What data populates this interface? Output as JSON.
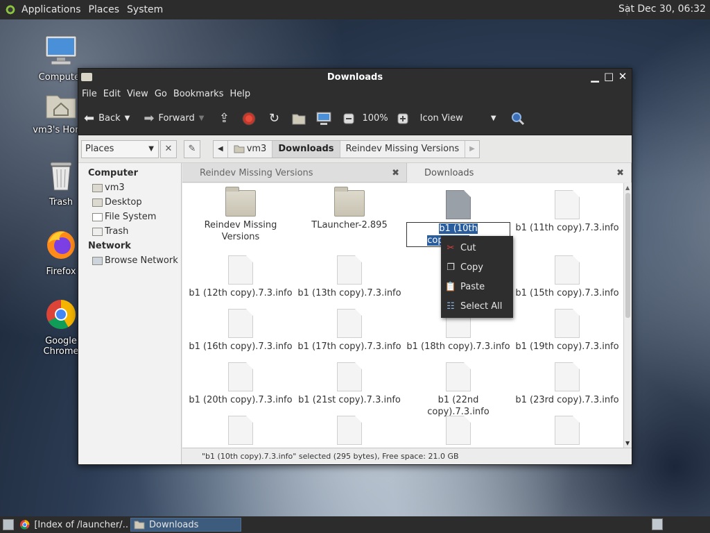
{
  "top_panel": {
    "menus": [
      "Applications",
      "Places",
      "System"
    ],
    "clock": "Sat Dec 30, 06:32"
  },
  "desktop_icons": [
    {
      "label": "Computer"
    },
    {
      "label": "vm3's Home"
    },
    {
      "label": "Trash"
    },
    {
      "label": "Firefox"
    },
    {
      "label": "Google Chrome"
    }
  ],
  "window": {
    "title": "Downloads",
    "menubar": [
      "File",
      "Edit",
      "View",
      "Go",
      "Bookmarks",
      "Help"
    ],
    "toolbar": {
      "back": "Back",
      "forward": "Forward",
      "zoom": "100%",
      "view_mode": "Icon View"
    },
    "location": {
      "places_label": "Places",
      "crumbs": [
        "vm3",
        "Downloads",
        "Reindev Missing Versions"
      ]
    },
    "sidebar": {
      "computer_head": "Computer",
      "computer_items": [
        "vm3",
        "Desktop",
        "File System",
        "Trash"
      ],
      "network_head": "Network",
      "network_items": [
        "Browse Network"
      ]
    },
    "tabs": [
      {
        "label": "Reindev Missing Versions"
      },
      {
        "label": "Downloads"
      }
    ],
    "files": [
      {
        "name": "Reindev Missing Versions",
        "type": "folder"
      },
      {
        "name": "TLauncher-2.895",
        "type": "folder"
      },
      {
        "name": "b1 (10th copy).7.3.info",
        "type": "doc",
        "selected": true,
        "rename_highlight": "b1 (10th copy).7.3",
        "rename_rest": ".info"
      },
      {
        "name": "b1 (11th copy).7.3.info",
        "type": "doc"
      },
      {
        "name": "b1 (12th copy).7.3.info",
        "type": "doc"
      },
      {
        "name": "b1 (13th copy).7.3.info",
        "type": "doc"
      },
      {
        "name": "b1 (14t",
        "type": "doc"
      },
      {
        "name": "b1 (15th copy).7.3.info",
        "type": "doc"
      },
      {
        "name": "b1 (16th copy).7.3.info",
        "type": "doc"
      },
      {
        "name": "b1 (17th copy).7.3.info",
        "type": "doc"
      },
      {
        "name": "b1 (18th copy).7.3.info",
        "type": "doc"
      },
      {
        "name": "b1 (19th copy).7.3.info",
        "type": "doc"
      },
      {
        "name": "b1 (20th copy).7.3.info",
        "type": "doc"
      },
      {
        "name": "b1 (21st copy).7.3.info",
        "type": "doc"
      },
      {
        "name": "b1 (22nd copy).7.3.info",
        "type": "doc"
      },
      {
        "name": "b1 (23rd copy).7.3.info",
        "type": "doc"
      },
      {
        "name": "",
        "type": "doc"
      },
      {
        "name": "",
        "type": "doc"
      },
      {
        "name": "",
        "type": "doc"
      },
      {
        "name": "",
        "type": "doc"
      }
    ],
    "status": "\"b1 (10th copy).7.3.info\" selected (295 bytes), Free space: 21.0 GB",
    "context_menu": [
      {
        "label": "Cut",
        "icon": "scissors-icon"
      },
      {
        "label": "Copy",
        "icon": "copy-icon"
      },
      {
        "label": "Paste",
        "icon": "paste-icon"
      },
      {
        "label": "Select All",
        "icon": "select-all-icon"
      }
    ]
  },
  "taskbar": {
    "tasks": [
      {
        "label": "[Index of /launcher/…",
        "icon": "chrome-icon"
      },
      {
        "label": "Downloads",
        "icon": "folder-icon",
        "active": true
      }
    ]
  }
}
